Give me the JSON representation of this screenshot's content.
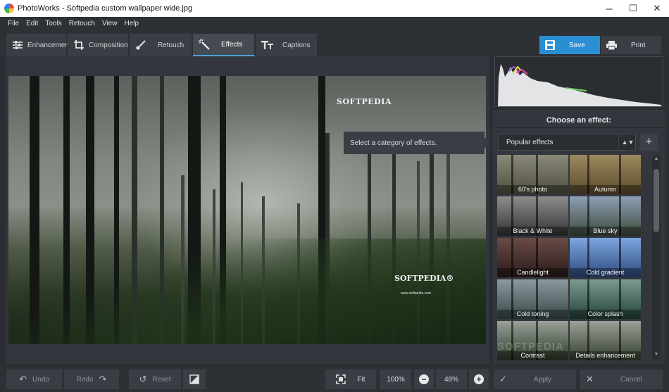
{
  "window": {
    "title": "PhotoWorks - Softpedia custom wallpaper wide.jpg",
    "minimize_icon": "─",
    "maximize_icon": "☐",
    "close_icon": "✕"
  },
  "menu": [
    "File",
    "Edit",
    "Tools",
    "Retouch",
    "View",
    "Help"
  ],
  "tabs": [
    {
      "label": "Enhancement",
      "icon": "sliders-icon",
      "active": false
    },
    {
      "label": "Composition",
      "icon": "crop-icon",
      "active": false
    },
    {
      "label": "Retouch",
      "icon": "brush-icon",
      "active": false
    },
    {
      "label": "Effects",
      "icon": "magic-wand-icon",
      "active": true
    },
    {
      "label": "Captions",
      "icon": "text-icon",
      "active": false
    }
  ],
  "toolbar": {
    "save_label": "Save",
    "print_label": "Print",
    "accent": "#2a8ed3"
  },
  "canvas": {
    "watermark_top": "SOFTPEDIA",
    "watermark_bottom": "SOFTPEDIA®",
    "watermark_url": "www.softpedia.com",
    "tooltip": "Select a category of effects."
  },
  "effects_panel": {
    "title": "Choose an effect:",
    "category": "Popular effects",
    "select_arrows": "▲▼",
    "add_icon": "+",
    "panel_watermark": "SOFTPEDIA",
    "effects": [
      {
        "label": "60's photo",
        "tint": "#6b6a5a"
      },
      {
        "label": "Autumn",
        "tint": "#7a6a45"
      },
      {
        "label": "Black & White",
        "tint": "#5e5e5e"
      },
      {
        "label": "Blue sky",
        "tint": "#5b6470"
      },
      {
        "label": "Candlelight",
        "tint": "#4a3330"
      },
      {
        "label": "Cold gradient",
        "tint": "#3d5a86"
      },
      {
        "label": "Cold toning",
        "tint": "#5a6a6f"
      },
      {
        "label": "Color splash",
        "tint": "#3f6a5e"
      },
      {
        "label": "Contrast",
        "tint": "#4d5548"
      },
      {
        "label": "Details enhancement",
        "tint": "#58604f"
      }
    ]
  },
  "bottom": {
    "undo_label": "Undo",
    "redo_label": "Redo",
    "reset_label": "Reset",
    "fit_label": "Fit",
    "zoom_100": "100%",
    "zoom_level": "48%",
    "minus_icon": "−",
    "plus_icon": "+",
    "apply_label": "Apply",
    "cancel_label": "Cancel"
  }
}
